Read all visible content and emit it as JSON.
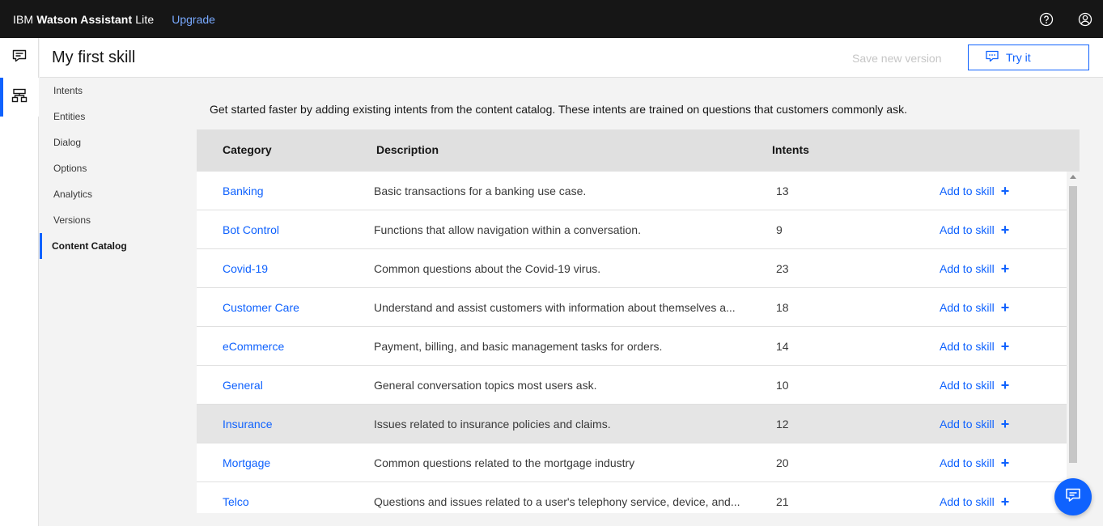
{
  "header": {
    "brand_company": "IBM",
    "brand_product": "Watson Assistant",
    "brand_plan": "Lite",
    "upgrade_label": "Upgrade",
    "icons": [
      "help-icon",
      "user-avatar-icon"
    ]
  },
  "rail": {
    "items": [
      {
        "icon": "chat-icon",
        "active": false
      },
      {
        "icon": "skills-icon",
        "active": true
      }
    ]
  },
  "page": {
    "title": "My first skill",
    "save_version_label": "Save new version",
    "try_it_label": "Try it"
  },
  "leftnav": {
    "items": [
      {
        "label": "Intents",
        "active": false
      },
      {
        "label": "Entities",
        "active": false
      },
      {
        "label": "Dialog",
        "active": false
      },
      {
        "label": "Options",
        "active": false
      },
      {
        "label": "Analytics",
        "active": false
      },
      {
        "label": "Versions",
        "active": false
      },
      {
        "label": "Content Catalog",
        "active": true
      }
    ]
  },
  "catalog": {
    "intro": "Get started faster by adding existing intents from the content catalog. These intents are trained on questions that customers commonly ask.",
    "columns": {
      "category": "Category",
      "description": "Description",
      "intents": "Intents"
    },
    "add_label": "Add to skill",
    "rows": [
      {
        "category": "Banking",
        "description": "Basic transactions for a banking use case.",
        "intents": "13"
      },
      {
        "category": "Bot Control",
        "description": "Functions that allow navigation within a conversation.",
        "intents": "9"
      },
      {
        "category": "Covid-19",
        "description": "Common questions about the Covid-19 virus.",
        "intents": "23"
      },
      {
        "category": "Customer Care",
        "description": "Understand and assist customers with information about themselves a...",
        "intents": "18"
      },
      {
        "category": "eCommerce",
        "description": "Payment, billing, and basic management tasks for orders.",
        "intents": "14"
      },
      {
        "category": "General",
        "description": "General conversation topics most users ask.",
        "intents": "10"
      },
      {
        "category": "Insurance",
        "description": "Issues related to insurance policies and claims.",
        "intents": "12"
      },
      {
        "category": "Mortgage",
        "description": "Common questions related to the mortgage industry",
        "intents": "20"
      },
      {
        "category": "Telco",
        "description": "Questions and issues related to a user's telephony service, device, and...",
        "intents": "21"
      }
    ]
  },
  "colors": {
    "accent": "#0f62fe",
    "topbar": "#161616",
    "upgrade": "#78a9ff"
  }
}
